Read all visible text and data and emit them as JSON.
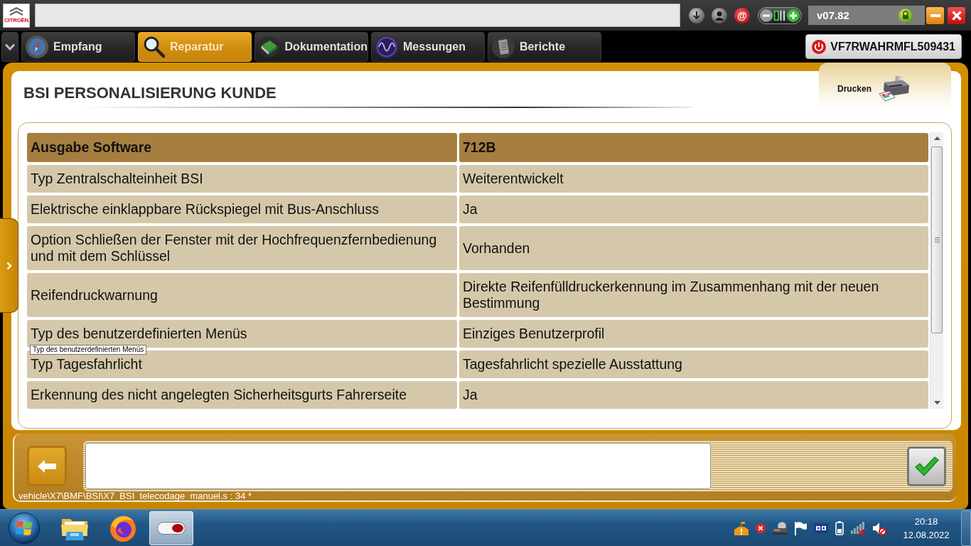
{
  "top_bar": {
    "logo_text": "CITROËN",
    "at_symbol": "@",
    "version": "v07.82"
  },
  "tabs": [
    {
      "label": "Empfang",
      "kind": "compass",
      "selected": false
    },
    {
      "label": "Reparatur",
      "kind": "magnifier",
      "selected": true
    },
    {
      "label": "Dokumentation",
      "kind": "book",
      "selected": false
    },
    {
      "label": "Messungen",
      "kind": "wave",
      "selected": false
    },
    {
      "label": "Berichte",
      "kind": "document",
      "selected": false
    }
  ],
  "vehicle": {
    "vin": "VF7RWAHRMFL509431"
  },
  "page": {
    "title": "BSI PERSONALISIERUNG KUNDE",
    "print_button": "Drucken"
  },
  "table": {
    "rows": [
      {
        "name": "Ausgabe Software",
        "value": "712B",
        "selected": true
      },
      {
        "name": "Typ Zentralschalteinheit BSI",
        "value": "Weiterentwickelt",
        "selected": false
      },
      {
        "name": "Elektrische einklappbare Rückspiegel mit Bus-Anschluss",
        "value": "Ja",
        "selected": false
      },
      {
        "name": "Option Schließen der Fenster mit der Hochfrequenzfernbedienung und mit dem Schlüssel",
        "value": "Vorhanden",
        "selected": false
      },
      {
        "name": "Reifendruckwarnung",
        "value": "Direkte Reifenfülldruckerkennung im Zusammenhang mit der neuen Bestimmung",
        "selected": false
      },
      {
        "name": "Typ des benutzerdefinierten Menüs",
        "value": "Einziges Benutzerprofil",
        "selected": false
      },
      {
        "name": "Typ Tagesfahrlicht",
        "value": "Tagesfahrlicht spezielle Ausstattung",
        "selected": false
      },
      {
        "name": "Erkennung des nicht angelegten Sicherheitsgurts Fahrerseite",
        "value": "Ja",
        "selected": false
      }
    ]
  },
  "tooltip": "Typ des benutzerdefinierten Menüs",
  "action_bar": {
    "file_path": "vehicle\\X7\\BMF\\BSI\\X7_BSI_telecodage_manuel.s : 34 *"
  },
  "taskbar": {
    "apps": [
      {
        "kind": "folder",
        "selected": false
      },
      {
        "kind": "browser",
        "selected": false
      },
      {
        "kind": "toggle",
        "selected": true
      }
    ],
    "time": "20:18",
    "date": "12.08.2022"
  }
}
